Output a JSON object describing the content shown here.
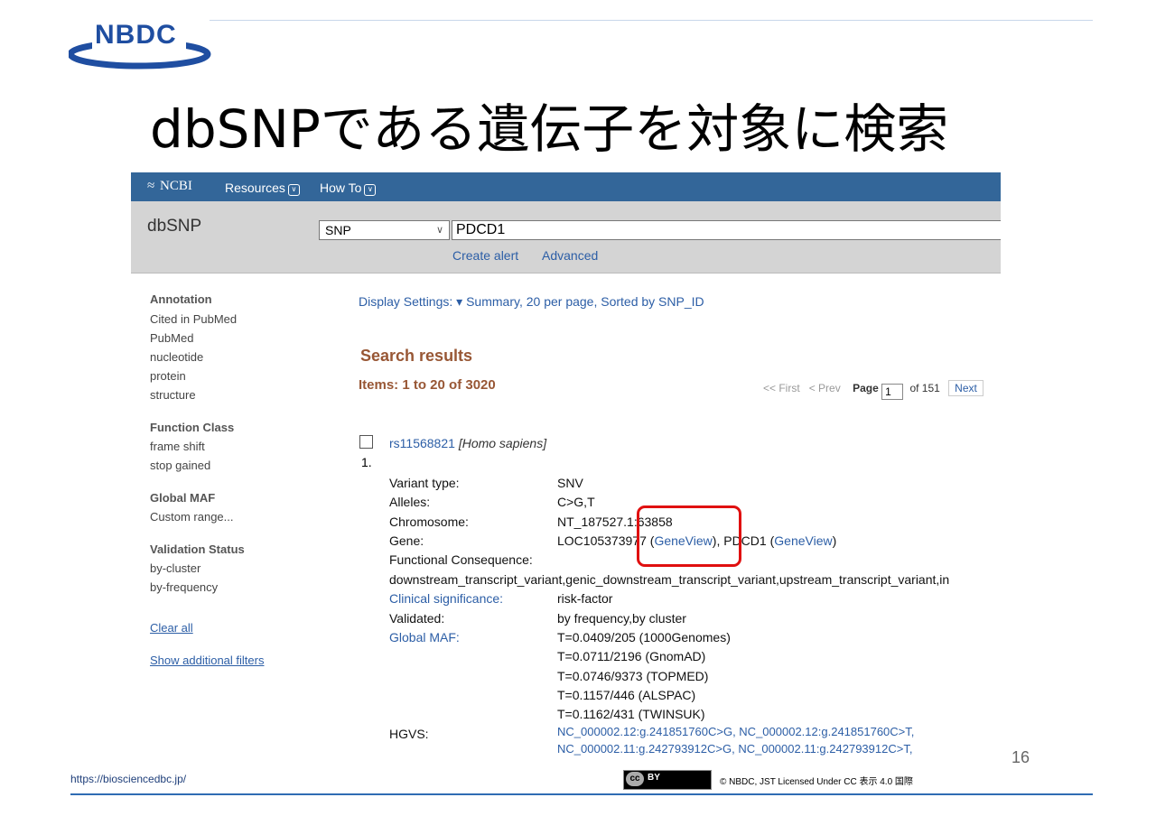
{
  "slide": {
    "logo": "NBDC",
    "title": "dbSNPである遺伝子を対象に検索",
    "url": "https://biosciencedbc.jp/",
    "cc_left": "cc",
    "cc_right": "BY",
    "copyright": "© NBDC, JST   Licensed Under CC 表示 4.0 国際",
    "page_number": "16",
    "accent_color": "#1f4ea1"
  },
  "ncbi": {
    "logo": "NCBI",
    "nav": [
      "Resources",
      "How To"
    ],
    "bar_color": "#336699"
  },
  "search": {
    "db_title": "dbSNP",
    "db_selected": "SNP",
    "query": "PDCD1",
    "links": [
      "Create alert",
      "Advanced"
    ]
  },
  "sidebar": {
    "groups": [
      {
        "heading": "Annotation",
        "items": [
          "Cited in PubMed",
          "PubMed",
          "nucleotide",
          "protein",
          "structure"
        ]
      },
      {
        "heading": "Function Class",
        "items": [
          "frame shift",
          "stop gained"
        ]
      },
      {
        "heading": "Global MAF",
        "items": [
          "Custom range..."
        ]
      },
      {
        "heading": "Validation Status",
        "items": [
          "by-cluster",
          "by-frequency"
        ]
      }
    ],
    "clear_all": "Clear all",
    "show_filters": "Show additional filters"
  },
  "main": {
    "display_settings": "Display Settings:",
    "display_caret": "▾",
    "display_summary": "Summary, 20 per page, Sorted by SNP_ID",
    "results_heading": "Search results",
    "items_count": "Items: 1 to 20 of 3020",
    "pager": {
      "first": "<< First",
      "prev": "< Prev",
      "page_label": "Page",
      "page": "1",
      "of": "of 151",
      "next": "Next"
    }
  },
  "result": {
    "number": "1.",
    "id": "rs11568821",
    "species": "[Homo sapiens]",
    "variant_type_label": "Variant type:",
    "variant_type": "SNV",
    "alleles_label": "Alleles:",
    "alleles": "C>G,T",
    "chromosome_label": "Chromosome:",
    "chromosome": "NT_187527.1:63858",
    "gene_label": "Gene:",
    "gene1": "LOC105373977",
    "geneview": "GeneView",
    "gene2": "PDCD1",
    "consequence_label": "Functional Consequence:",
    "consequence": "downstream_transcript_variant,genic_downstream_transcript_variant,upstream_transcript_variant,in",
    "clinical_label": "Clinical significance:",
    "clinical": "risk-factor",
    "validated_label": "Validated:",
    "validated": "by frequency,by cluster",
    "maf_label": "Global MAF:",
    "maf": [
      "T=0.0409/205 (1000Genomes)",
      "T=0.0711/2196 (GnomAD)",
      "T=0.0746/9373 (TOPMED)",
      "T=0.1157/446 (ALSPAC)",
      "T=0.1162/431 (TWINSUK)"
    ],
    "hgvs_label": "HGVS:",
    "hgvs": [
      "NC_000002.12:g.241851760C>G, NC_000002.12:g.241851760C>T,",
      "NC_000002.11:g.242793912C>G, NC_000002.11:g.242793912C>T,"
    ]
  }
}
